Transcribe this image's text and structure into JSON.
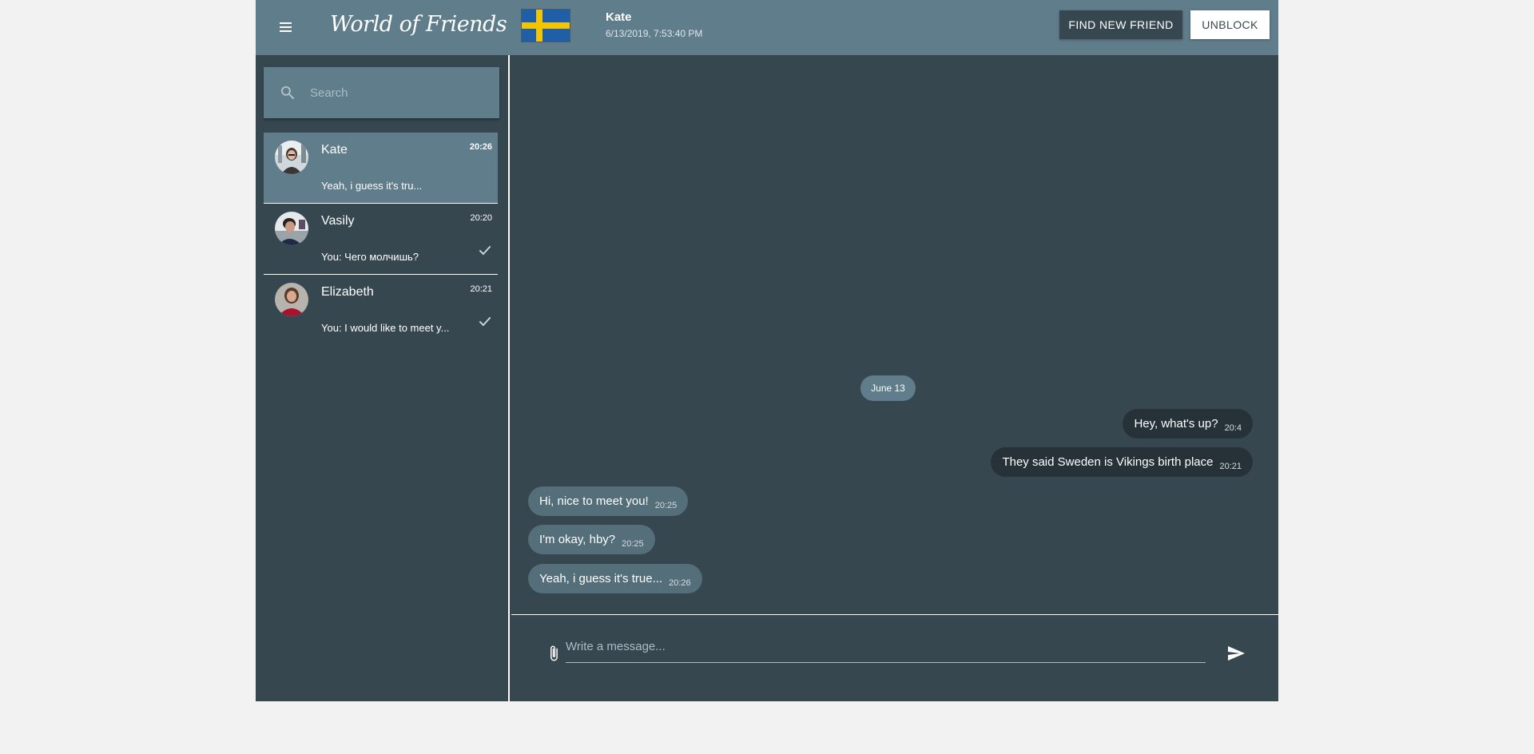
{
  "app": {
    "brand": "World of Friends"
  },
  "header": {
    "menu_icon": "hamburger-menu-icon",
    "flag": "sweden-flag",
    "peer_name": "Kate",
    "peer_last_seen": "6/13/2019, 7:53:40 PM",
    "find_button": "FIND NEW FRIEND",
    "unblock_button": "UNBLOCK"
  },
  "sidebar": {
    "search_placeholder": "Search",
    "contacts": [
      {
        "name": "Kate",
        "time": "20:26",
        "preview": "Yeah, i guess it's tru...",
        "active": true,
        "read": false
      },
      {
        "name": "Vasily",
        "time": "20:20",
        "preview": "You: Чего молчишь?",
        "active": false,
        "read": true
      },
      {
        "name": "Elizabeth",
        "time": "20:21",
        "preview": "You: I would like to meet y...",
        "active": false,
        "read": true
      }
    ]
  },
  "chat": {
    "date_label": "June 13",
    "messages": [
      {
        "direction": "out",
        "text": "Hey, what's up?",
        "time": "20:4"
      },
      {
        "direction": "out",
        "text": "They said Sweden is Vikings birth place",
        "time": "20:21"
      },
      {
        "direction": "in",
        "text": "Hi, nice to meet you!",
        "time": "20:25"
      },
      {
        "direction": "in",
        "text": "I'm okay, hby?",
        "time": "20:25"
      },
      {
        "direction": "in",
        "text": "Yeah, i guess it's true...",
        "time": "20:26"
      }
    ]
  },
  "composer": {
    "placeholder": "Write a message...",
    "attach_icon": "paperclip-icon",
    "send_icon": "send-icon"
  },
  "colors": {
    "header_bg": "#607d8b",
    "panel_bg": "#37474f",
    "outgoing_bubble": "#263238",
    "incoming_bubble": "#546e7a",
    "page_bg": "#f2f2f2"
  }
}
